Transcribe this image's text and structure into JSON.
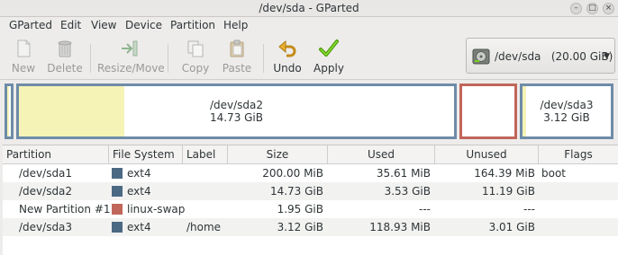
{
  "window": {
    "title": "/dev/sda - GParted"
  },
  "menu": [
    "GParted",
    "Edit",
    "View",
    "Device",
    "Partition",
    "Help"
  ],
  "toolbar": {
    "new": "New",
    "delete": "Delete",
    "resize_move": "Resize/Move",
    "copy": "Copy",
    "paste": "Paste",
    "undo": "Undo",
    "apply": "Apply"
  },
  "device_selector": {
    "value": "/dev/sda   (20.00 GiB)"
  },
  "disk_map": {
    "sda2": {
      "name": "/dev/sda2",
      "size": "14.73 GiB"
    },
    "sda3": {
      "name": "/dev/sda3",
      "size": "3.12 GiB"
    }
  },
  "table": {
    "headers": [
      "Partition",
      "File System",
      "Label",
      "Size",
      "Used",
      "Unused",
      "Flags"
    ],
    "rows": [
      {
        "partition": "/dev/sda1",
        "fs": "ext4",
        "fs_color": "#4b6983",
        "label": "",
        "size": "200.00 MiB",
        "used": "35.61 MiB",
        "unused": "164.39 MiB",
        "flags": "boot"
      },
      {
        "partition": "/dev/sda2",
        "fs": "ext4",
        "fs_color": "#4b6983",
        "label": "",
        "size": "14.73 GiB",
        "used": "3.53 GiB",
        "unused": "11.19 GiB",
        "flags": ""
      },
      {
        "partition": "New Partition #1",
        "fs": "linux-swap",
        "fs_color": "#c1665a",
        "label": "",
        "size": "1.95 GiB",
        "used": "---",
        "unused": "---",
        "flags": ""
      },
      {
        "partition": "/dev/sda3",
        "fs": "ext4",
        "fs_color": "#4b6983",
        "label": "/home",
        "size": "3.12 GiB",
        "used": "118.93 MiB",
        "unused": "3.01 GiB",
        "flags": ""
      }
    ]
  },
  "colors": {
    "ext4": "#4b6983",
    "swap": "#c1665a",
    "used": "#f6f3b7",
    "partition_border": "#6e8ca8"
  }
}
